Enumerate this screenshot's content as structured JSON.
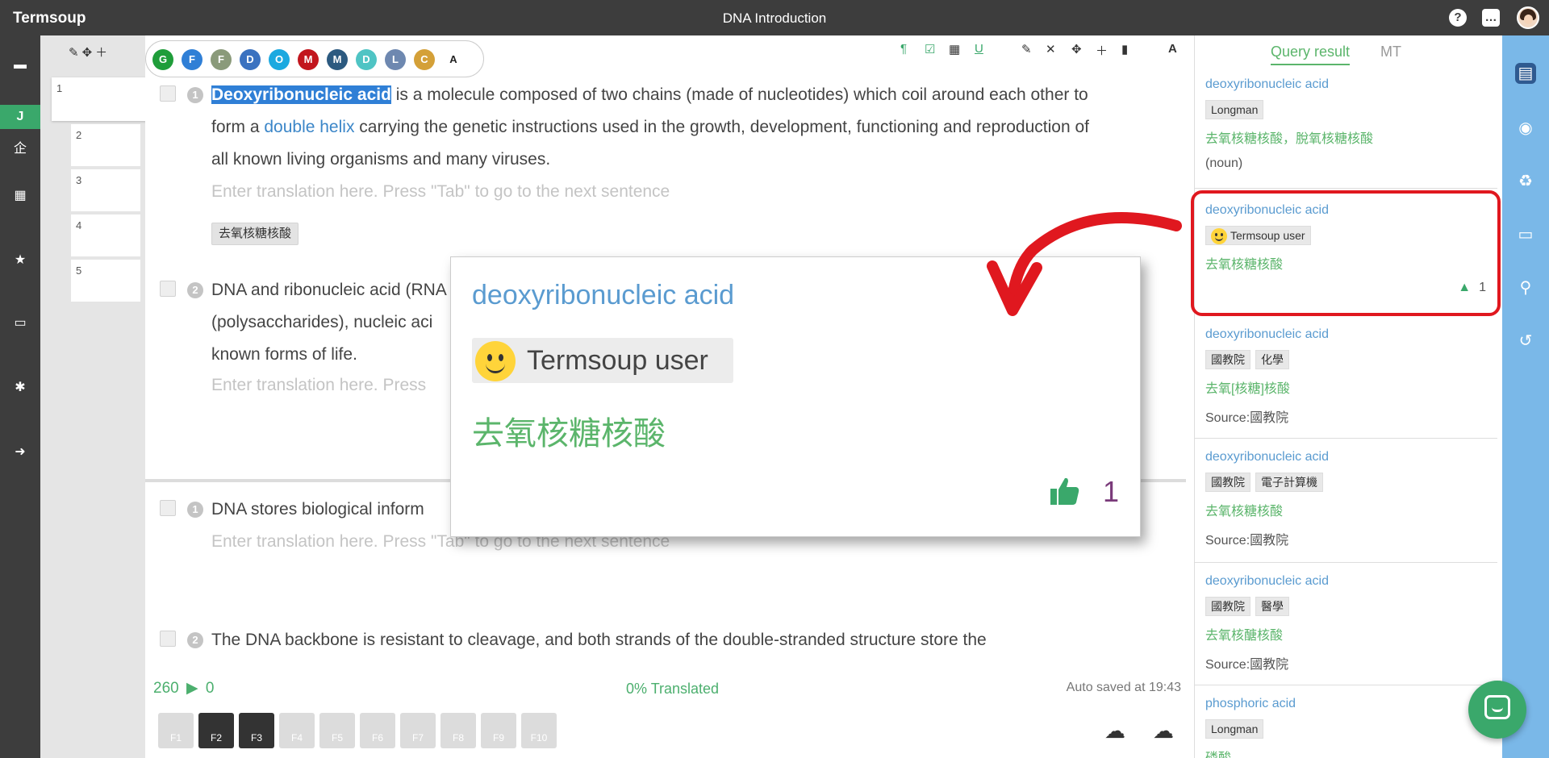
{
  "app": {
    "brand": "Termsoup",
    "doc_title": "DNA Introduction"
  },
  "left_rail": {
    "active_label": "J",
    "company_label": "企"
  },
  "segments": [
    "1",
    "2",
    "3",
    "4",
    "5"
  ],
  "languages": [
    {
      "letter": "G",
      "color": "#1f9d3a"
    },
    {
      "letter": "F",
      "color": "#2f7fd6"
    },
    {
      "letter": "F",
      "color": "#8a9a7a"
    },
    {
      "letter": "D",
      "color": "#3b72c0"
    },
    {
      "letter": "O",
      "color": "#1ba9e0"
    },
    {
      "letter": "M",
      "color": "#c2161e"
    },
    {
      "letter": "M",
      "color": "#2c5a80"
    },
    {
      "letter": "D",
      "color": "#4fc4c4"
    },
    {
      "letter": "L",
      "color": "#6e88b0"
    },
    {
      "letter": "C",
      "color": "#d4a038"
    },
    {
      "letter": "A",
      "color": "#ffffff"
    }
  ],
  "editor": {
    "seg1": {
      "num": "1",
      "highlight": "Deoxyribonucleic acid",
      "text_a": " is a molecule composed of two chains (made of nucleotides) which coil around each other to form a ",
      "link": "double helix",
      "text_b": " carrying the genetic instructions used in the growth, development, functioning and reproduction of all known living organisms and many viruses.",
      "placeholder": "Enter translation here. Press \"Tab\" to go to the next sentence",
      "tag": "去氧核糖核酸"
    },
    "seg2": {
      "num": "2",
      "line1": "DNA and ribonucleic acid (RNA",
      "line2": "(polysaccharides), nucleic aci",
      "line3": "known forms of life.",
      "placeholder": "Enter translation here. Press"
    },
    "seg3": {
      "num": "1",
      "line1": "DNA stores biological inform",
      "placeholder": "Enter translation here. Press \"Tab\" to go to the next sentence"
    },
    "seg4": {
      "num": "2",
      "line1": "The DNA backbone is resistant to cleavage, and both strands of the double-stranded structure store the"
    }
  },
  "status": {
    "left_count": "260",
    "right_count": "0",
    "translated": "0% Translated",
    "autosave": "Auto saved at 19:43"
  },
  "fkeys": [
    "F1",
    "F2",
    "F3",
    "F4",
    "F5",
    "F6",
    "F7",
    "F8",
    "F9",
    "F10"
  ],
  "popup": {
    "term": "deoxyribonucleic acid",
    "user": "Termsoup user",
    "translation": "去氧核糖核酸",
    "likes": "1"
  },
  "query_panel": {
    "tab_active": "Query result",
    "tab_inactive": "MT",
    "cards": [
      {
        "term": "deoxyribonucleic acid",
        "chips": [
          "Longman"
        ],
        "translation": "去氧核糖核酸，脫氧核糖核酸",
        "extra": "(noun)"
      },
      {
        "term": "deoxyribonucleic acid",
        "user": "Termsoup user",
        "translation": "去氧核糖核酸",
        "likes": "1"
      },
      {
        "term": "deoxyribonucleic acid",
        "chips": [
          "國教院",
          "化學"
        ],
        "translation": "去氧[核糖]核酸",
        "source": "Source:國教院"
      },
      {
        "term": "deoxyribonucleic acid",
        "chips": [
          "國教院",
          "電子計算機"
        ],
        "translation": "去氧核糖核酸",
        "source": "Source:國教院"
      },
      {
        "term": "deoxyribonucleic acid",
        "chips": [
          "國教院",
          "醫學"
        ],
        "translation": "去氧核醣核酸",
        "source": "Source:國教院"
      },
      {
        "term": "phosphoric acid",
        "chips": [
          "Longman"
        ],
        "translation": "磷酸"
      }
    ]
  }
}
